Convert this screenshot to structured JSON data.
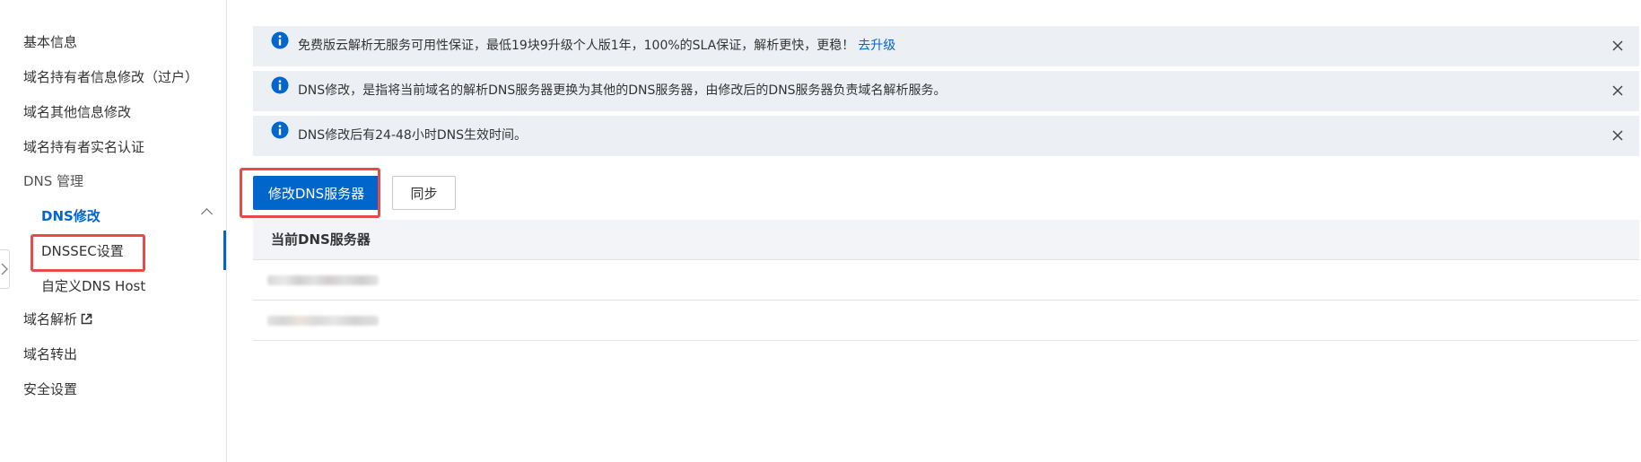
{
  "sidebar": {
    "items": [
      {
        "label": "基本信息"
      },
      {
        "label": "域名持有者信息修改（过户）"
      },
      {
        "label": "域名其他信息修改"
      },
      {
        "label": "域名持有者实名认证"
      },
      {
        "label": "DNS 管理",
        "expanded": true
      },
      {
        "label": "DNS修改",
        "active": true
      },
      {
        "label": "DNSSEC设置"
      },
      {
        "label": "自定义DNS Host"
      },
      {
        "label": "域名解析",
        "icon": "external-link-icon"
      },
      {
        "label": "域名转出"
      },
      {
        "label": "安全设置"
      }
    ]
  },
  "banners": [
    {
      "text": "免费版云解析无服务可用性保证，最低19块9升级个人版1年，100%的SLA保证，解析更快，更稳！",
      "link": "去升级",
      "icon": "info-icon"
    },
    {
      "text": "DNS修改，是指将当前域名的解析DNS服务器更换为其他的DNS服务器，由修改后的DNS服务器负责域名解析服务。",
      "icon": "info-icon"
    },
    {
      "text": "DNS修改后有24-48小时DNS生效时间。",
      "icon": "info-icon"
    }
  ],
  "actions": {
    "modify_label": "修改DNS服务器",
    "sync_label": "同步"
  },
  "table": {
    "header": "当前DNS服务器",
    "rows": [
      "",
      ""
    ]
  },
  "colors": {
    "primary": "#0066cc",
    "banner_bg": "#ecf0f5",
    "highlight": "#e84a4a"
  }
}
